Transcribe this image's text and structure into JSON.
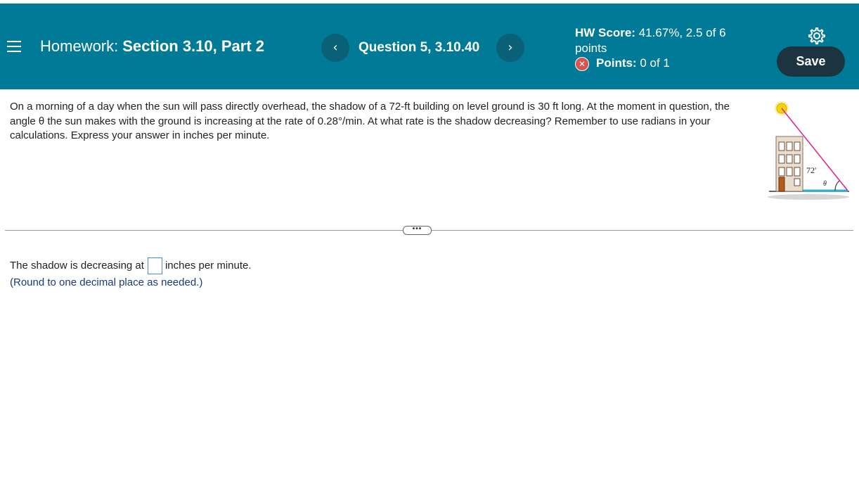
{
  "header": {
    "title_prefix": "Homework:",
    "title_section": "Section 3.10, Part 2",
    "question_label": "Question 5, 3.10.40",
    "prev_glyph": "‹",
    "next_glyph": "›",
    "hw_score_label": "HW Score:",
    "hw_score_value": "41.67%, 2.5 of 6 points",
    "points_label": "Points:",
    "points_value": "0 of 1",
    "incorrect_glyph": "✕",
    "save_label": "Save",
    "icons": [
      "menu-icon",
      "chevron-left-icon",
      "chevron-right-icon",
      "incorrect-icon",
      "gear-icon"
    ]
  },
  "problem": {
    "text": "On a morning of a day when the sun will pass directly overhead, the shadow of a 72-ft building on level ground is 30 ft long. At the moment in question, the angle θ the sun makes with the ground is increasing at the rate of 0.28°/min. At what rate is the shadow decreasing? Remember to use radians in your calculations. Express your answer in inches per minute."
  },
  "figure": {
    "height_label": "72′",
    "angle_label": "θ"
  },
  "answer": {
    "prefix": "The shadow is decreasing at",
    "suffix": "inches per minute.",
    "hint": "(Round to one decimal place as needed.)",
    "value": ""
  },
  "divider": {
    "expand_label": "•••"
  },
  "colors": {
    "header_bg": "#007a96",
    "save_bg": "#1c3440",
    "incorrect": "#d9534f",
    "hint_text": "#1a3a7a"
  }
}
